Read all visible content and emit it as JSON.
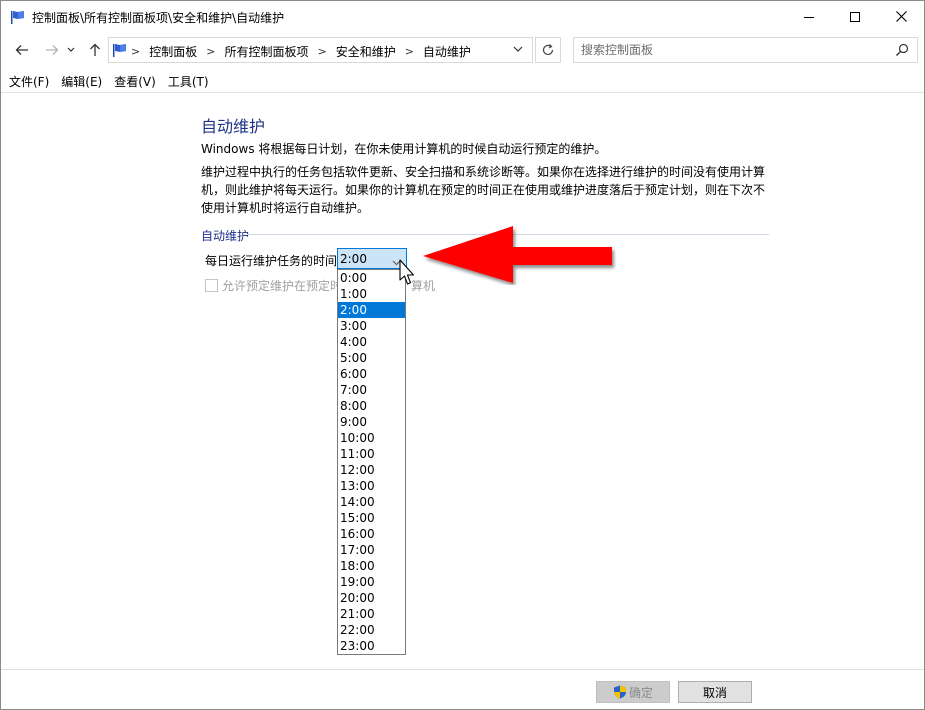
{
  "window": {
    "title": "控制面板\\所有控制面板项\\安全和维护\\自动维护"
  },
  "address": {
    "breadcrumbs": [
      "控制面板",
      "所有控制面板项",
      "安全和维护",
      "自动维护"
    ]
  },
  "search": {
    "placeholder": "搜索控制面板"
  },
  "menu": {
    "items": [
      "文件(F)",
      "编辑(E)",
      "查看(V)",
      "工具(T)"
    ]
  },
  "content": {
    "title": "自动维护",
    "paragraph1": "Windows 将根据每日计划，在你未使用计算机的时候自动运行预定的维护。",
    "paragraph2": "维护过程中执行的任务包括软件更新、安全扫描和系统诊断等。如果你在选择进行维护的时间没有使用计算机，则此维护将每天运行。如果你的计算机在预定的时间正在使用或维护进度落后于预定计划，则在下次不使用计算机时将运行自动维护。",
    "section_label": "自动维护",
    "time_label": "每日运行维护任务的时间",
    "time_selected": "2:00",
    "checkbox_label_visible": "允许预定维护在预定时",
    "checkbox_label_tail": "算机"
  },
  "dropdown": {
    "options": [
      "0:00",
      "1:00",
      "2:00",
      "3:00",
      "4:00",
      "5:00",
      "6:00",
      "7:00",
      "8:00",
      "9:00",
      "10:00",
      "11:00",
      "12:00",
      "13:00",
      "14:00",
      "15:00",
      "16:00",
      "17:00",
      "18:00",
      "19:00",
      "20:00",
      "21:00",
      "22:00",
      "23:00"
    ],
    "selected_index": 2
  },
  "buttons": {
    "ok": "确定",
    "cancel": "取消"
  },
  "colors": {
    "title_blue": "#1e3287",
    "selection_blue": "#0078d7",
    "arrow_red": "#ff0000"
  }
}
